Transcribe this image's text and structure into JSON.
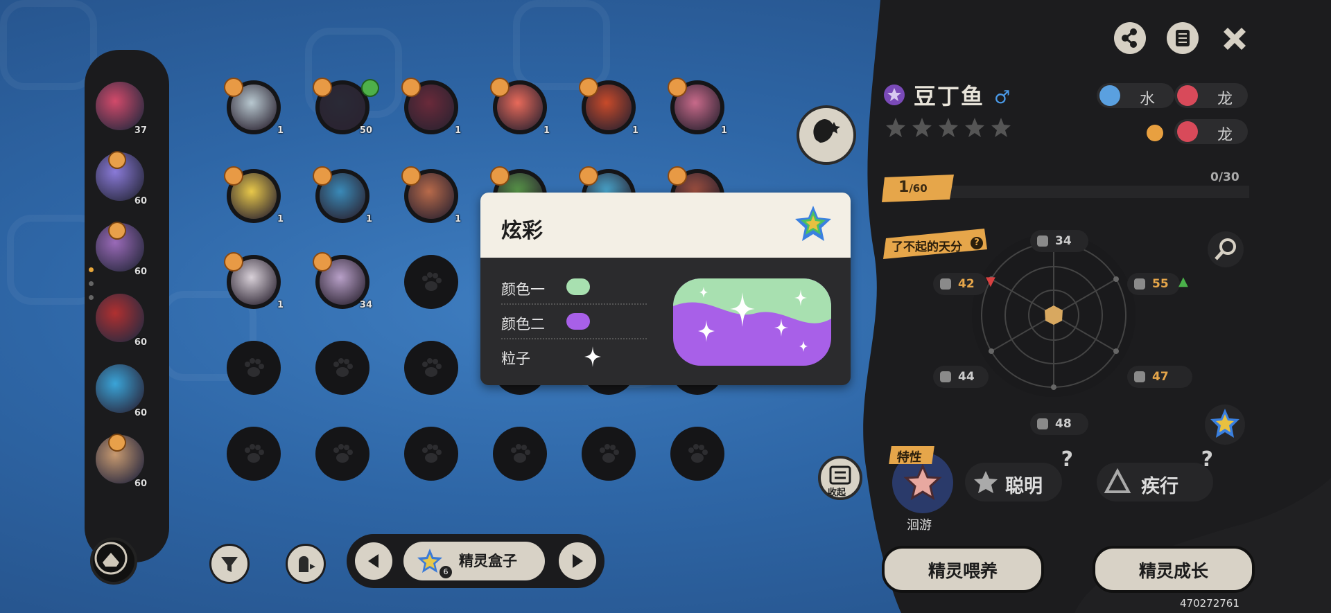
{
  "roster": {
    "items": [
      {
        "level": "37",
        "color": "#d24a6a",
        "badge": false
      },
      {
        "level": "60",
        "color": "#8a7ad8",
        "badge": true
      },
      {
        "level": "60",
        "color": "#9a6ab8",
        "badge": true
      },
      {
        "level": "60",
        "color": "#b03030",
        "badge": false
      },
      {
        "level": "60",
        "color": "#3aa4d8",
        "badge": false
      },
      {
        "level": "60",
        "color": "#c89a70",
        "badge": true
      }
    ]
  },
  "grid": {
    "row1": [
      {
        "level": "1",
        "color": "#b8c8d0"
      },
      {
        "level": "50",
        "color": "#2a2a36"
      },
      {
        "level": "1",
        "color": "#6a2a3a"
      },
      {
        "level": "1",
        "color": "#e86a5a"
      },
      {
        "level": "1",
        "color": "#c84a2a"
      },
      {
        "level": "1",
        "color": "#c86a8a"
      }
    ],
    "row2": [
      {
        "level": "1",
        "color": "#e8c84a"
      },
      {
        "level": "1",
        "color": "#3a8ab8"
      },
      {
        "level": "1",
        "color": "#b86a4a"
      },
      {
        "level": "",
        "color": "#5a9a4a"
      },
      {
        "level": "",
        "color": "#4aa8d0"
      },
      {
        "level": "",
        "color": "#a05040"
      }
    ],
    "row3": [
      {
        "level": "1",
        "color": "#d8d0d8"
      },
      {
        "level": "34",
        "color": "#b8a0c8"
      }
    ]
  },
  "collapse_label": "收起",
  "pager": {
    "label": "精灵盒子",
    "count": "6"
  },
  "popup": {
    "title": "炫彩",
    "color1_label": "颜色一",
    "color1": "#a8e0b0",
    "color2_label": "颜色二",
    "color2": "#a860e8",
    "particle_label": "粒子"
  },
  "spirit": {
    "name": "豆丁鱼",
    "gender": "♂",
    "types_row1": [
      "水",
      "龙"
    ],
    "types_row2": [
      "龙"
    ],
    "level": "1",
    "level_max": "/60",
    "exp": "0/30",
    "talent": "了不起的天分",
    "stats": {
      "hp": "34",
      "atk": "42",
      "matk": "55",
      "def": "44",
      "mdef": "47",
      "spd": "48"
    },
    "trait_tag": "特性",
    "trait_name": "洄游",
    "ability1": "聪明",
    "ability2": "疾行",
    "feed_button": "精灵喂养",
    "grow_button": "精灵成长"
  },
  "uid": "470272761",
  "colors": {
    "accent_orange": "#e6a64a",
    "stat_up": "#4ab04a",
    "stat_down": "#d84040",
    "panel_dark": "#1c1c1e"
  }
}
